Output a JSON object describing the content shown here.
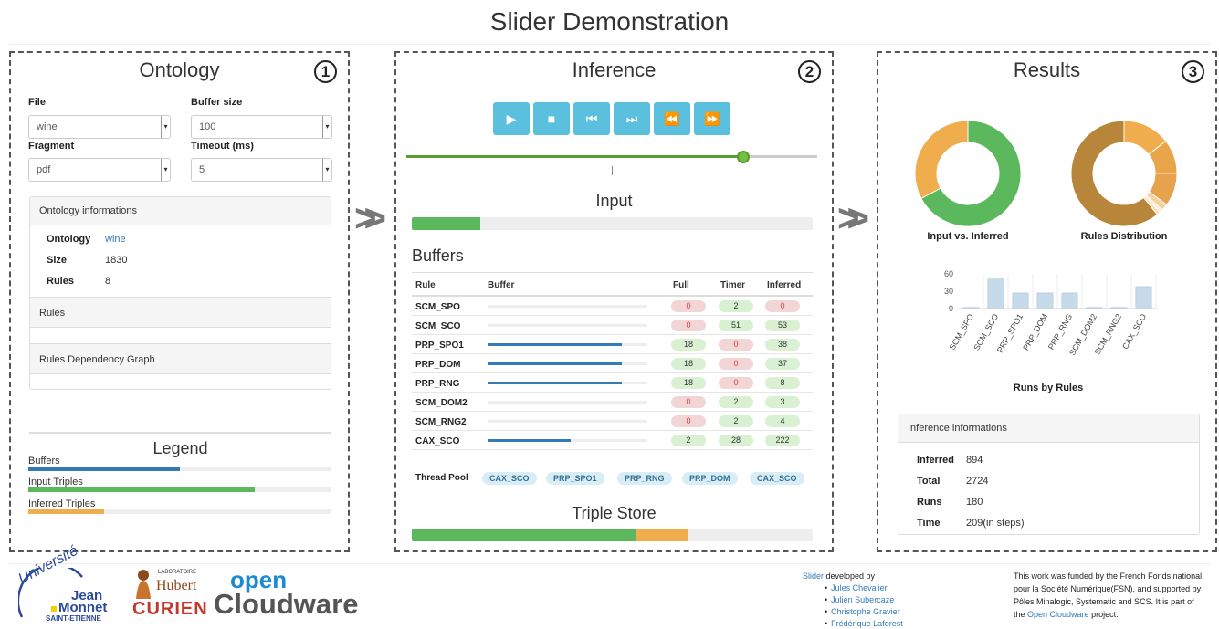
{
  "page": {
    "title": "Slider Demonstration"
  },
  "ontology": {
    "title": "Ontology",
    "step": "1",
    "file_label": "File",
    "file_value": "wine",
    "buffer_size_label": "Buffer size",
    "buffer_size_value": "100",
    "fragment_label": "Fragment",
    "fragment_value": "pdf",
    "timeout_label": "Timeout (ms)",
    "timeout_value": "5",
    "info_header": "Ontology informations",
    "info": {
      "ontology_key": "Ontology",
      "ontology_val": "wine",
      "size_key": "Size",
      "size_val": "1830",
      "rules_key": "Rules",
      "rules_val": "8"
    },
    "rules_header": "Rules",
    "graph_header": "Rules Dependency Graph",
    "legend": {
      "title": "Legend",
      "items": [
        {
          "label": "Buffers",
          "color": "#337ab7",
          "fill": 0.5
        },
        {
          "label": "Input Triples",
          "color": "#5cb85c",
          "fill": 0.75
        },
        {
          "label": "Inferred Triples",
          "color": "#f0ad4e",
          "fill": 0.25
        }
      ]
    }
  },
  "inference": {
    "title": "Inference",
    "step": "2",
    "controls": [
      {
        "icon": "play-icon",
        "glyph": "▶"
      },
      {
        "icon": "stop-icon",
        "glyph": "■"
      },
      {
        "icon": "step-back-icon",
        "glyph": "⏮"
      },
      {
        "icon": "step-forward-icon",
        "glyph": "⏭"
      },
      {
        "icon": "rewind-icon",
        "glyph": "⏪"
      },
      {
        "icon": "fast-forward-icon",
        "glyph": "⏩"
      }
    ],
    "slider_value": 0.82,
    "input_title": "Input",
    "input_progress": 0.17,
    "buffers_title": "Buffers",
    "columns": [
      "Rule",
      "Buffer",
      "Full",
      "Timer",
      "Inferred"
    ],
    "rows": [
      {
        "rule": "SCM_SPO",
        "buffer": 0.0,
        "full": "0",
        "full_state": "red",
        "timer": "2",
        "timer_state": "green",
        "inferred": "0",
        "inferred_state": "red"
      },
      {
        "rule": "SCM_SCO",
        "buffer": 0.0,
        "full": "0",
        "full_state": "red",
        "timer": "51",
        "timer_state": "green",
        "inferred": "53",
        "inferred_state": "green"
      },
      {
        "rule": "PRP_SPO1",
        "buffer": 0.84,
        "full": "18",
        "full_state": "green",
        "timer": "0",
        "timer_state": "red",
        "inferred": "38",
        "inferred_state": "green"
      },
      {
        "rule": "PRP_DOM",
        "buffer": 0.84,
        "full": "18",
        "full_state": "green",
        "timer": "0",
        "timer_state": "red",
        "inferred": "37",
        "inferred_state": "green"
      },
      {
        "rule": "PRP_RNG",
        "buffer": 0.84,
        "full": "18",
        "full_state": "green",
        "timer": "0",
        "timer_state": "red",
        "inferred": "8",
        "inferred_state": "green"
      },
      {
        "rule": "SCM_DOM2",
        "buffer": 0.0,
        "full": "0",
        "full_state": "red",
        "timer": "2",
        "timer_state": "green",
        "inferred": "3",
        "inferred_state": "green"
      },
      {
        "rule": "SCM_RNG2",
        "buffer": 0.0,
        "full": "0",
        "full_state": "red",
        "timer": "2",
        "timer_state": "green",
        "inferred": "4",
        "inferred_state": "green"
      },
      {
        "rule": "CAX_SCO",
        "buffer": 0.52,
        "full": "2",
        "full_state": "green",
        "timer": "28",
        "timer_state": "green",
        "inferred": "222",
        "inferred_state": "green"
      }
    ],
    "thread_pool_label": "Thread Pool",
    "thread_pool": [
      "CAX_SCO",
      "PRP_SPO1",
      "PRP_RNG",
      "PRP_DOM",
      "CAX_SCO"
    ],
    "triple_store_title": "Triple Store",
    "triple_store": {
      "input": 0.56,
      "inferred": 0.13
    }
  },
  "results": {
    "title": "Results",
    "step": "3",
    "input_vs_inferred_label": "Input vs. Inferred",
    "rules_distribution_label": "Rules Distribution",
    "runs_by_rules_label": "Runs by Rules",
    "info_header": "Inference informations",
    "info": [
      {
        "key": "Inferred",
        "val": "894"
      },
      {
        "key": "Total",
        "val": "2724"
      },
      {
        "key": "Runs",
        "val": "180"
      },
      {
        "key": "Time",
        "val": "209(in steps)"
      }
    ]
  },
  "chart_data": [
    {
      "type": "pie",
      "title": "Input vs. Inferred",
      "categories": [
        "Input",
        "Inferred"
      ],
      "values": [
        1830,
        894
      ],
      "colors": [
        "#5cb85c",
        "#f0ad4e"
      ]
    },
    {
      "type": "pie",
      "title": "Rules Distribution",
      "categories": [
        "SCM_SPO",
        "SCM_SCO",
        "PRP_SPO1",
        "PRP_DOM",
        "PRP_RNG",
        "SCM_DOM2",
        "SCM_RNG2",
        "CAX_SCO"
      ],
      "values": [
        0,
        53,
        38,
        37,
        8,
        3,
        4,
        222
      ],
      "colors": [
        "#f3c27a",
        "#f0ad4e",
        "#eaa44a",
        "#e6a24c",
        "#f4d3a1",
        "#fbe9cf",
        "#f8dfba",
        "#b8863a"
      ]
    },
    {
      "type": "bar",
      "title": "Runs by Rules",
      "categories": [
        "SCM_SPO",
        "SCM_SCO",
        "PRP_SPO1",
        "PRP_DOM",
        "PRP_RNG",
        "SCM_DOM2",
        "SCM_RNG2",
        "CAX_SCO"
      ],
      "values": [
        2,
        51,
        27,
        27,
        27,
        2,
        2,
        38
      ],
      "ylim": [
        0,
        60
      ],
      "yticks": [
        0,
        30,
        60
      ],
      "color": "#c6dbea"
    }
  ],
  "footer": {
    "logo_univ": [
      "Université",
      "Jean",
      "Monnet",
      "SAINT-ETIENNE"
    ],
    "logo_hubert": [
      "LABORATOIRE",
      "Hubert",
      "CURIEN"
    ],
    "logo_open": [
      "open",
      "Cloudware"
    ],
    "slider_link": "Slider",
    "developed_by": " developed by",
    "developers": [
      "Jules Chevalier",
      "Julien Subercaze",
      "Christophe Gravier",
      "Frédérique Laforest"
    ],
    "funding_text": "This work was funded by the French Fonds national pour la Société Numérique(FSN), and supported by Pôles Minalogic, Systematic and SCS. It is part of the ",
    "funding_link": "Open Cloudware",
    "funding_end": " project."
  }
}
